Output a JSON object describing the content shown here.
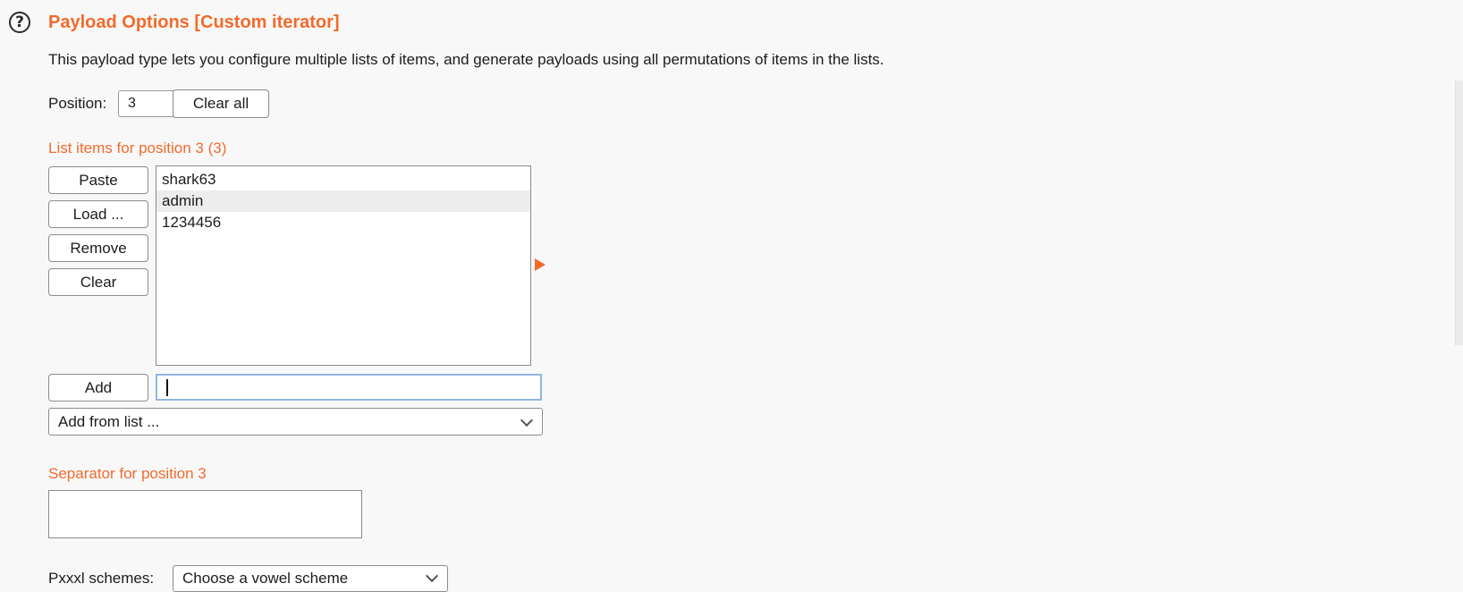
{
  "header": {
    "help_icon_glyph": "?",
    "title": "Payload Options [Custom iterator]",
    "description": "This payload type lets you configure multiple lists of items, and generate payloads using all permutations of items in the lists."
  },
  "position": {
    "label": "Position:",
    "value": "3",
    "clear_all_label": "Clear all"
  },
  "list": {
    "label": "List items for position 3 (3)",
    "buttons": {
      "paste": "Paste",
      "load": "Load ...",
      "remove": "Remove",
      "clear": "Clear",
      "add": "Add"
    },
    "items": [
      "shark63",
      "admin",
      "1234456"
    ],
    "add_input_value": "",
    "add_from_list": "Add from list ..."
  },
  "separator": {
    "label": "Separator for position 3",
    "value": ""
  },
  "scheme": {
    "label": "Pxxxl schemes:",
    "select_value": "Choose a vowel scheme"
  },
  "colors": {
    "accent": "#f26b2a",
    "focus": "#8fb6e0"
  },
  "icons": {
    "help": "help-circle-icon",
    "arrow": "play-arrow-icon",
    "dropdown": "chevron-down-icon"
  }
}
